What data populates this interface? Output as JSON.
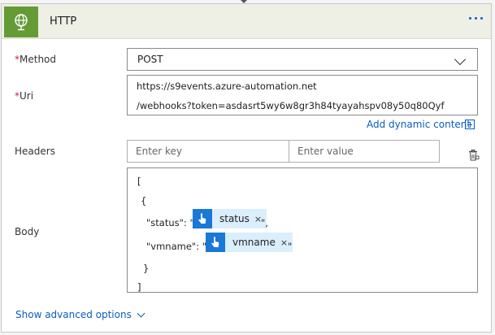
{
  "header": {
    "title": "HTTP",
    "icon": "globe-icon",
    "accent": "#659b35"
  },
  "method": {
    "label": "Method",
    "required_mark": "*",
    "value": "POST"
  },
  "uri": {
    "label": "Uri",
    "required_mark": "*",
    "lines": [
      "https://s9events.azure-automation.net",
      "/webhooks?token=asdasrt5wy6w8gr3h84tyayahspv08y50q80Qyf"
    ]
  },
  "dynamic_content": {
    "label": "Add dynamic content"
  },
  "headers": {
    "label": "Headers",
    "key_placeholder": "Enter key",
    "value_placeholder": "Enter value"
  },
  "body": {
    "label": "Body",
    "open_bracket": "[",
    "open_brace": "{",
    "status_key": "\"status\": \"",
    "status_token": "status",
    "status_suffix": "\",",
    "vmname_key": "\"vmname\": \"",
    "vmname_token": "vmname",
    "vmname_suffix": "\"",
    "close_brace": "}",
    "close_bracket": "]",
    "token_remove": "×"
  },
  "advanced": {
    "label": "Show advanced options"
  }
}
